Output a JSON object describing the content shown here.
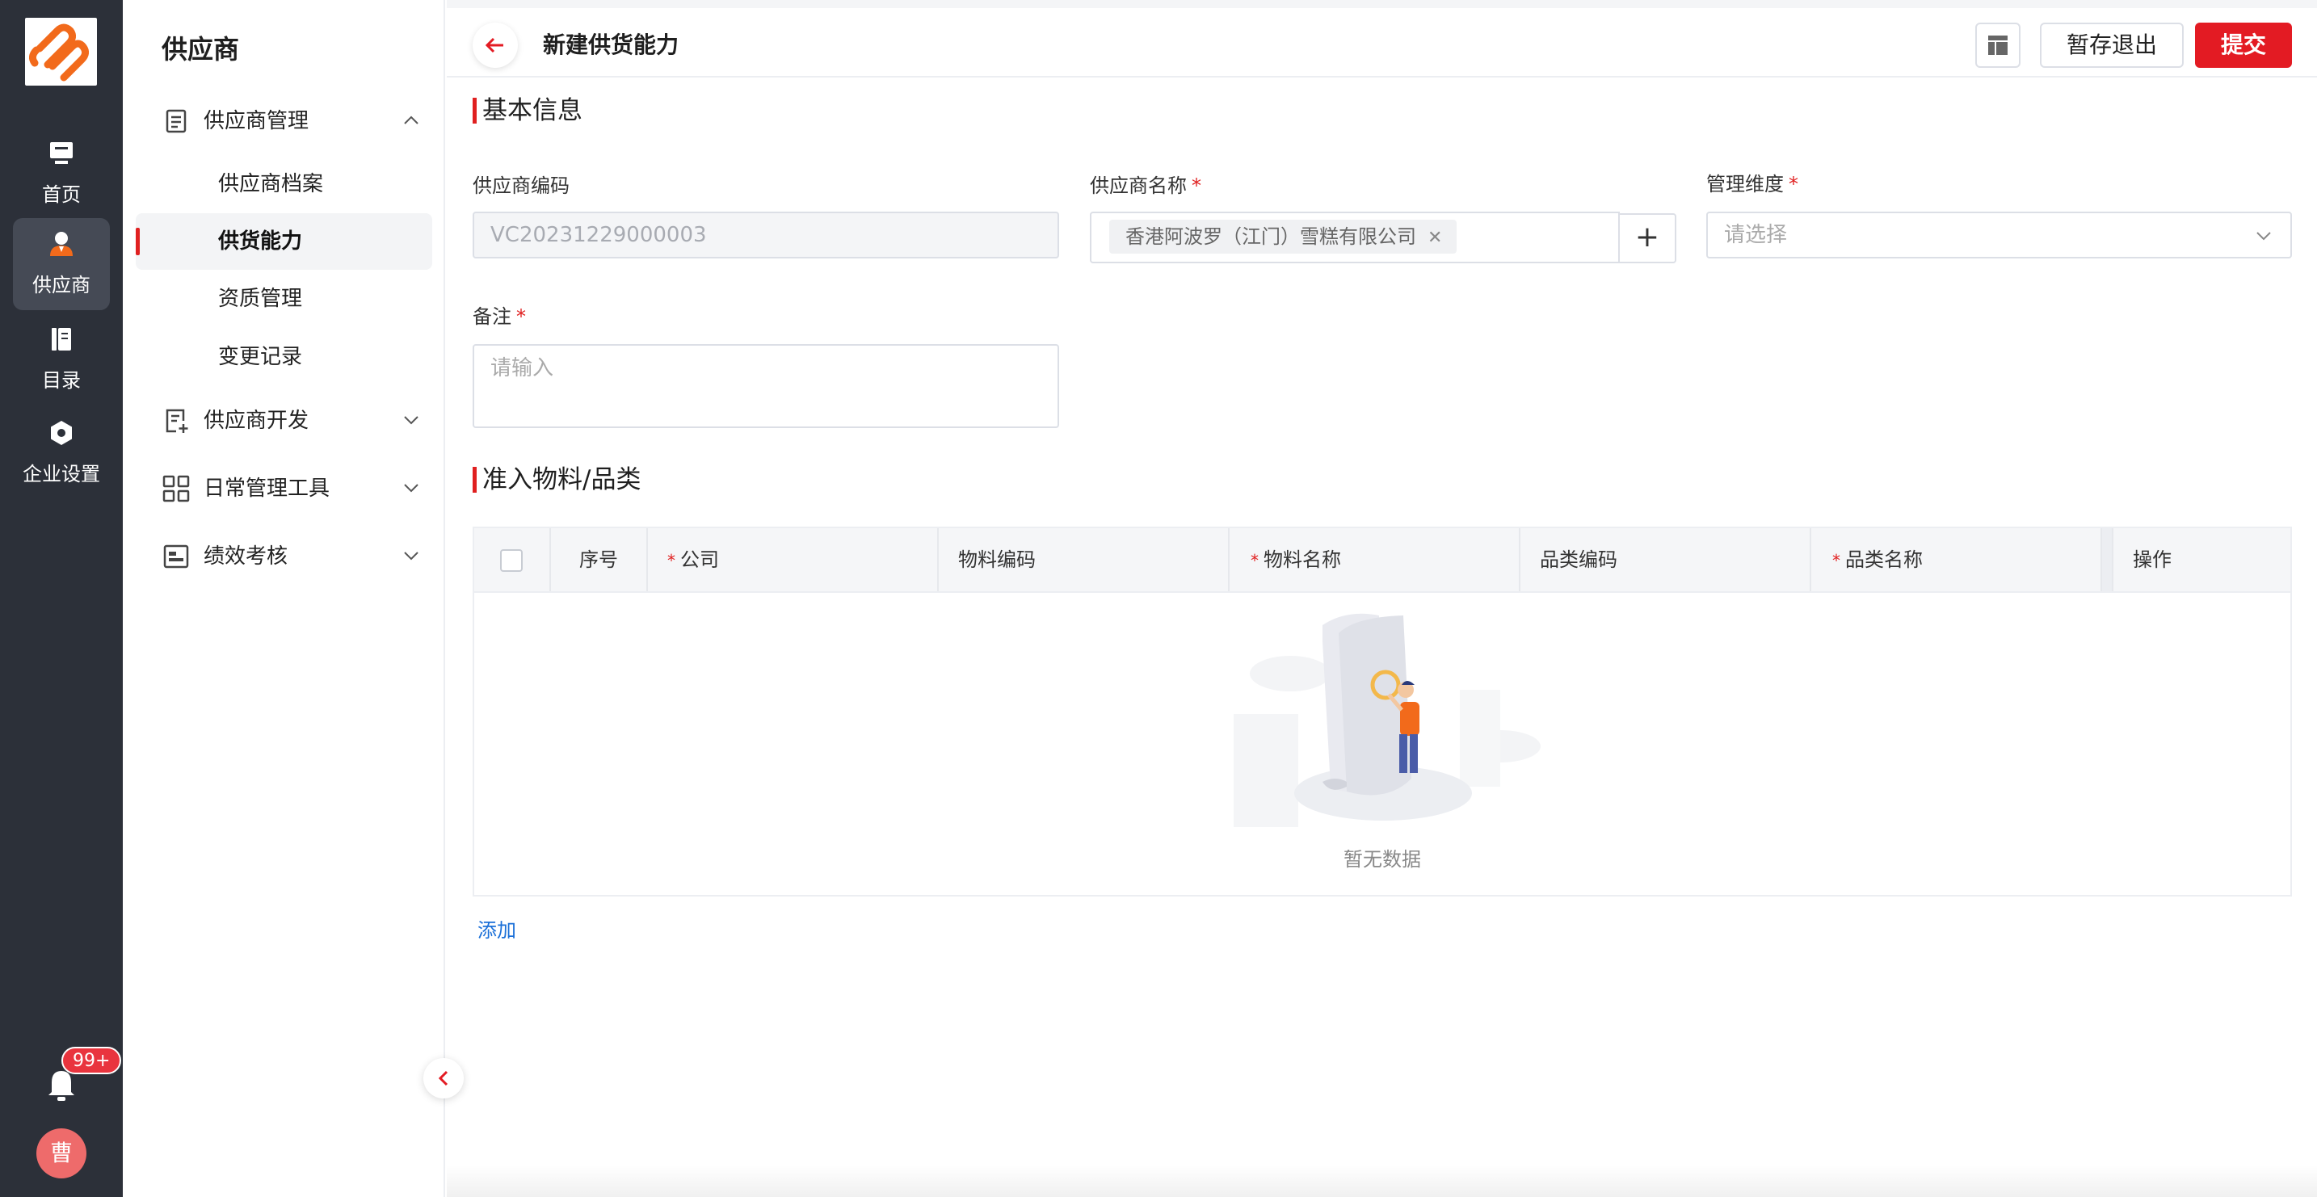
{
  "rail": {
    "items": [
      {
        "label": "首页",
        "icon": "monitor-icon"
      },
      {
        "label": "供应商",
        "icon": "person-icon"
      },
      {
        "label": "目录",
        "icon": "catalog-icon"
      },
      {
        "label": "企业设置",
        "icon": "settings-hex-icon"
      }
    ],
    "badge": "99+",
    "avatar_text": "曹"
  },
  "submenu": {
    "title": "供应商",
    "groups": [
      {
        "label": "供应商管理",
        "icon": "document-list-icon"
      },
      {
        "label": "供应商开发",
        "icon": "document-add-icon"
      },
      {
        "label": "日常管理工具",
        "icon": "grid-apps-icon"
      },
      {
        "label": "绩效考核",
        "icon": "chart-card-icon"
      }
    ],
    "items": [
      {
        "label": "供应商档案"
      },
      {
        "label": "供货能力"
      },
      {
        "label": "资质管理"
      },
      {
        "label": "变更记录"
      }
    ]
  },
  "header": {
    "title": "新建供货能力",
    "save_exit_label": "暂存退出",
    "submit_label": "提交"
  },
  "basic": {
    "section_title": "基本信息",
    "code_label": "供应商编码",
    "code_value": "VC20231229000003",
    "name_label": "供应商名称",
    "name_tag": "香港阿波罗（江门）雪糕有限公司",
    "dimension_label": "管理维度",
    "dimension_placeholder": "请选择",
    "remark_label": "备注",
    "remark_placeholder": "请输入",
    "required_mark": "*"
  },
  "materials": {
    "section_title": "准入物料/品类",
    "columns": [
      "序号",
      "公司",
      "物料编码",
      "物料名称",
      "品类编码",
      "品类名称",
      "操作"
    ],
    "empty_text": "暂无数据",
    "add_label": "添加"
  },
  "colors": {
    "accent": "#e31b23",
    "rail_bg": "#2c3039",
    "link": "#1a6fd8"
  }
}
